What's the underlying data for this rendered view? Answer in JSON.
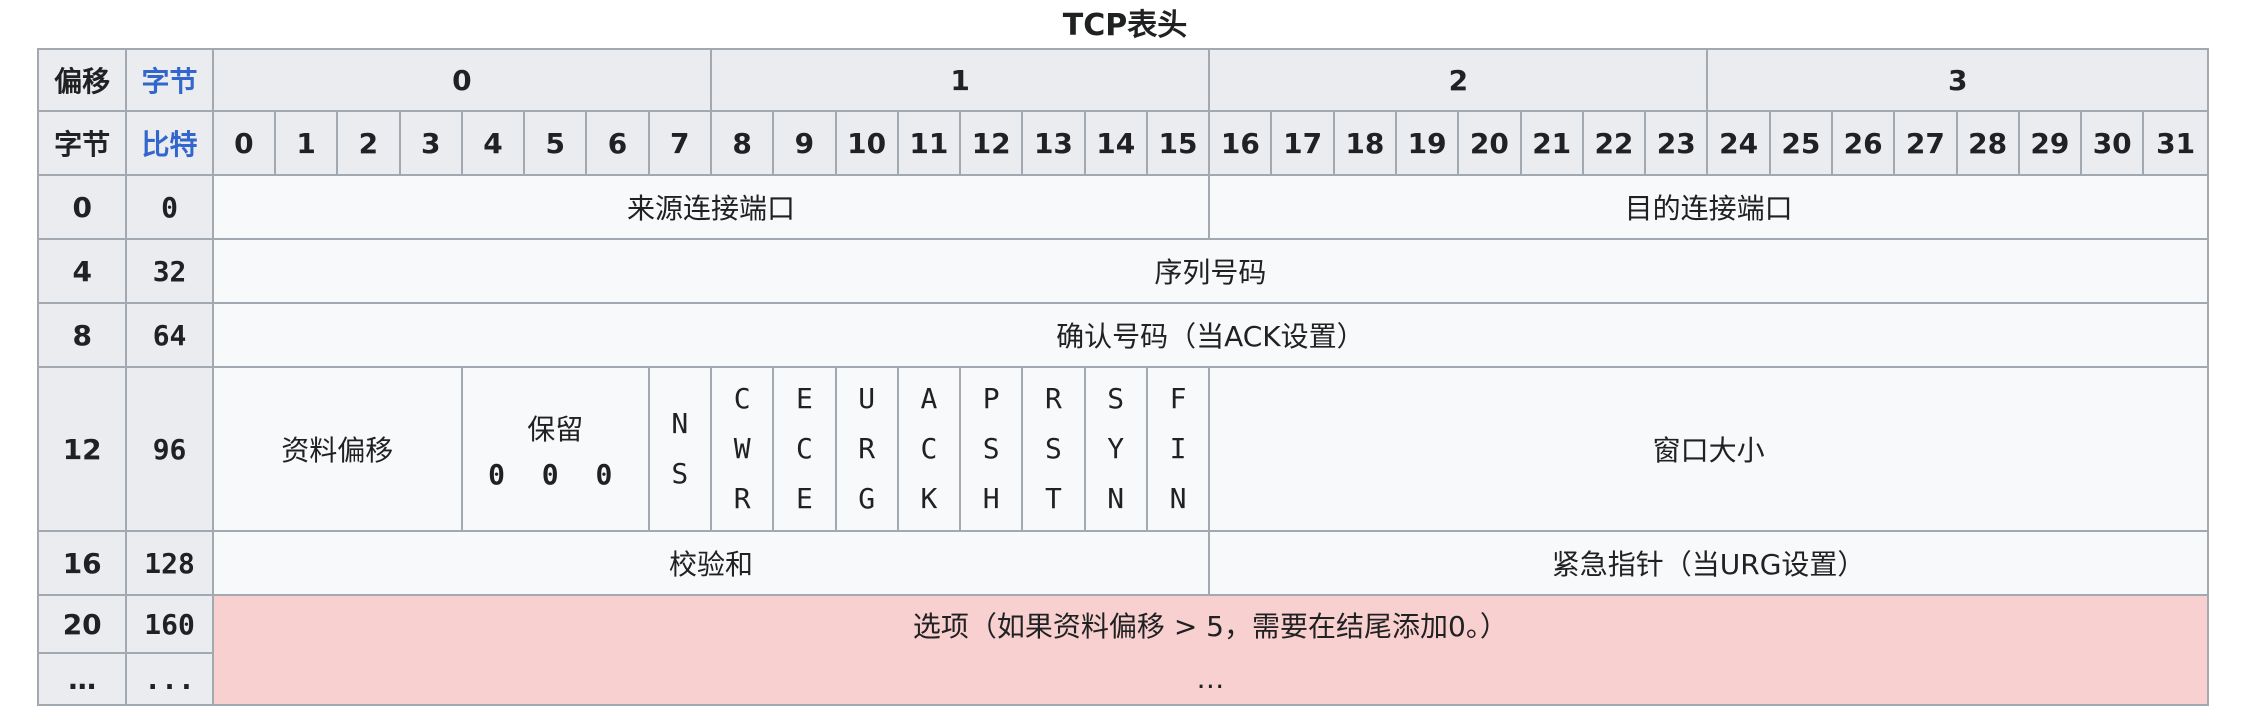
{
  "caption": "TCP表头",
  "header": {
    "offset_label": "偏移",
    "octet_label": "字节",
    "byte_label": "字节",
    "bit_label": "比特",
    "octets": [
      "0",
      "1",
      "2",
      "3"
    ],
    "bits": [
      "0",
      "1",
      "2",
      "3",
      "4",
      "5",
      "6",
      "7",
      "8",
      "9",
      "10",
      "11",
      "12",
      "13",
      "14",
      "15",
      "16",
      "17",
      "18",
      "19",
      "20",
      "21",
      "22",
      "23",
      "24",
      "25",
      "26",
      "27",
      "28",
      "29",
      "30",
      "31"
    ]
  },
  "rows": {
    "r0": {
      "byte": "0",
      "bit": "0",
      "src_port": "来源连接端口",
      "dst_port": "目的连接端口"
    },
    "r4": {
      "byte": "4",
      "bit": "32",
      "seq": "序列号码"
    },
    "r8": {
      "byte": "8",
      "bit": "64",
      "ack": "确认号码（当ACK设置）"
    },
    "r12": {
      "byte": "12",
      "bit": "96",
      "data_offset": "资料偏移",
      "reserved": "保留",
      "reserved_bits": "0 0 0",
      "flags": {
        "ns": [
          "N",
          "S"
        ],
        "cwr": [
          "C",
          "W",
          "R"
        ],
        "ece": [
          "E",
          "C",
          "E"
        ],
        "urg": [
          "U",
          "R",
          "G"
        ],
        "ack": [
          "A",
          "C",
          "K"
        ],
        "psh": [
          "P",
          "S",
          "H"
        ],
        "rst": [
          "R",
          "S",
          "T"
        ],
        "syn": [
          "S",
          "Y",
          "N"
        ],
        "fin": [
          "F",
          "I",
          "N"
        ]
      },
      "window": "窗口大小"
    },
    "r16": {
      "byte": "16",
      "bit": "128",
      "checksum": "校验和",
      "urgent": "紧急指针（当URG设置）"
    },
    "r20": {
      "byte": "20",
      "bit": "160",
      "byte_more": "…",
      "bit_more": "...",
      "options": "选项（如果资料偏移 > 5，需要在结尾添加0。）",
      "options_more": "…"
    }
  },
  "colors": {
    "header_bg": "#eaecf0",
    "cell_bg": "#f8f9fa",
    "options_bg": "#f8d0d0",
    "border": "#a2a9b1",
    "link_blue": "#3366cc"
  }
}
